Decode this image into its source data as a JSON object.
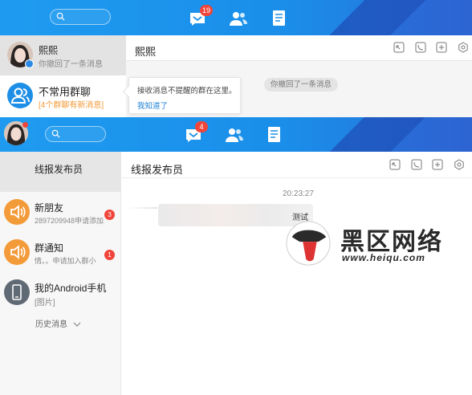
{
  "top_window": {
    "messages_badge": "19",
    "selected_contact": {
      "name": "熙熙",
      "preview": "你撤回了一条消息"
    },
    "group_row": {
      "name": "不常用群聊",
      "preview": "[4个群聊有新消息]"
    },
    "chat_title": "熙熙",
    "tooltip": {
      "text": "接收消息不提醒的群在这里。",
      "link": "我知道了"
    },
    "system_message": "你撤回了一条消息"
  },
  "bottom_window": {
    "messages_badge": "4",
    "selected_contact": {
      "name": "线报发布员"
    },
    "contacts": [
      {
        "name": "新朋友",
        "preview": "2897209948申请添加",
        "badge": "3",
        "icon": "speaker-icon"
      },
      {
        "name": "群通知",
        "preview": "情。。申请加入群小",
        "badge": "1",
        "icon": "speaker-icon"
      },
      {
        "name": "我的Android手机",
        "preview": "[图片]",
        "icon": "phone-icon"
      }
    ],
    "history_label": "历史消息",
    "chat_title": "线报发布员",
    "timestamp": "20:23:27",
    "message": "测试"
  },
  "watermark": {
    "brand": "黑区网络",
    "url": "www.heiqu.com"
  },
  "colors": {
    "accent": "#1e9bf0",
    "badge": "#f0453a",
    "orange": "#f39a39",
    "link": "#1a7fd6"
  }
}
